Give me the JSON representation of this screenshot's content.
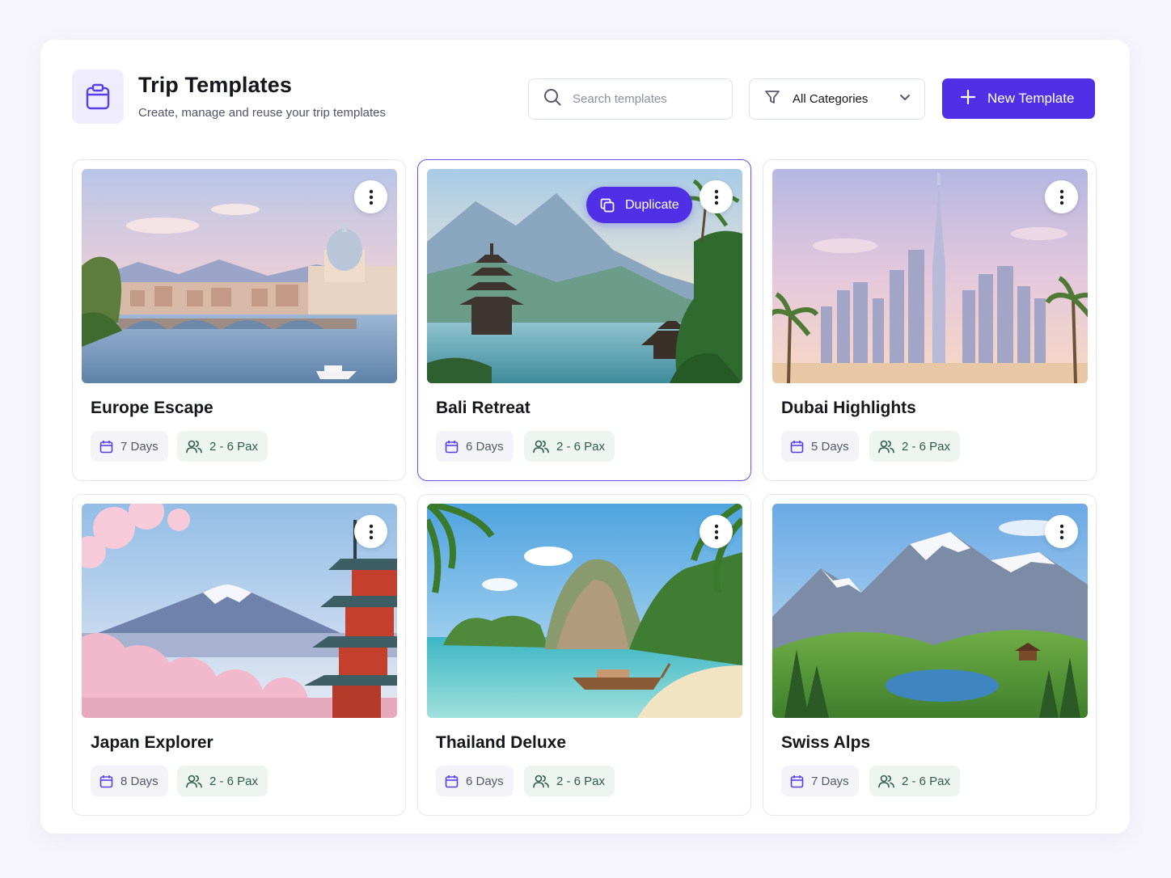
{
  "header": {
    "title": "Trip Templates",
    "subtitle": "Create, manage and reuse your trip templates",
    "icon": "clipboard-icon"
  },
  "search": {
    "placeholder": "Search templates",
    "value": ""
  },
  "filter": {
    "selected": "All Categories",
    "icon": "filter-icon"
  },
  "new_template_button": {
    "label": "New Template",
    "icon": "plus-icon"
  },
  "colors": {
    "accent": "#4f30e6",
    "accent_soft": "#efecfd",
    "pax_chip_bg": "#eef5f1",
    "pax_chip_text": "#2f5d4b"
  },
  "templates": [
    {
      "name": "Europe Escape",
      "days": "7 Days",
      "pax": "2 - 6 Pax"
    },
    {
      "name": "Bali Retreat",
      "days": "6 Days",
      "pax": "2 - 6 Pax",
      "action_label": "Duplicate"
    },
    {
      "name": "Dubai Highlights",
      "days": "5 Days",
      "pax": "2 - 6 Pax"
    },
    {
      "name": "Japan Explorer",
      "days": "8 Days",
      "pax": "2 - 6 Pax"
    },
    {
      "name": "Thailand Deluxe",
      "days": "6 Days",
      "pax": "2 - 6 Pax"
    },
    {
      "name": "Swiss Alps",
      "days": "7 Days",
      "pax": "2 - 6 Pax"
    }
  ]
}
